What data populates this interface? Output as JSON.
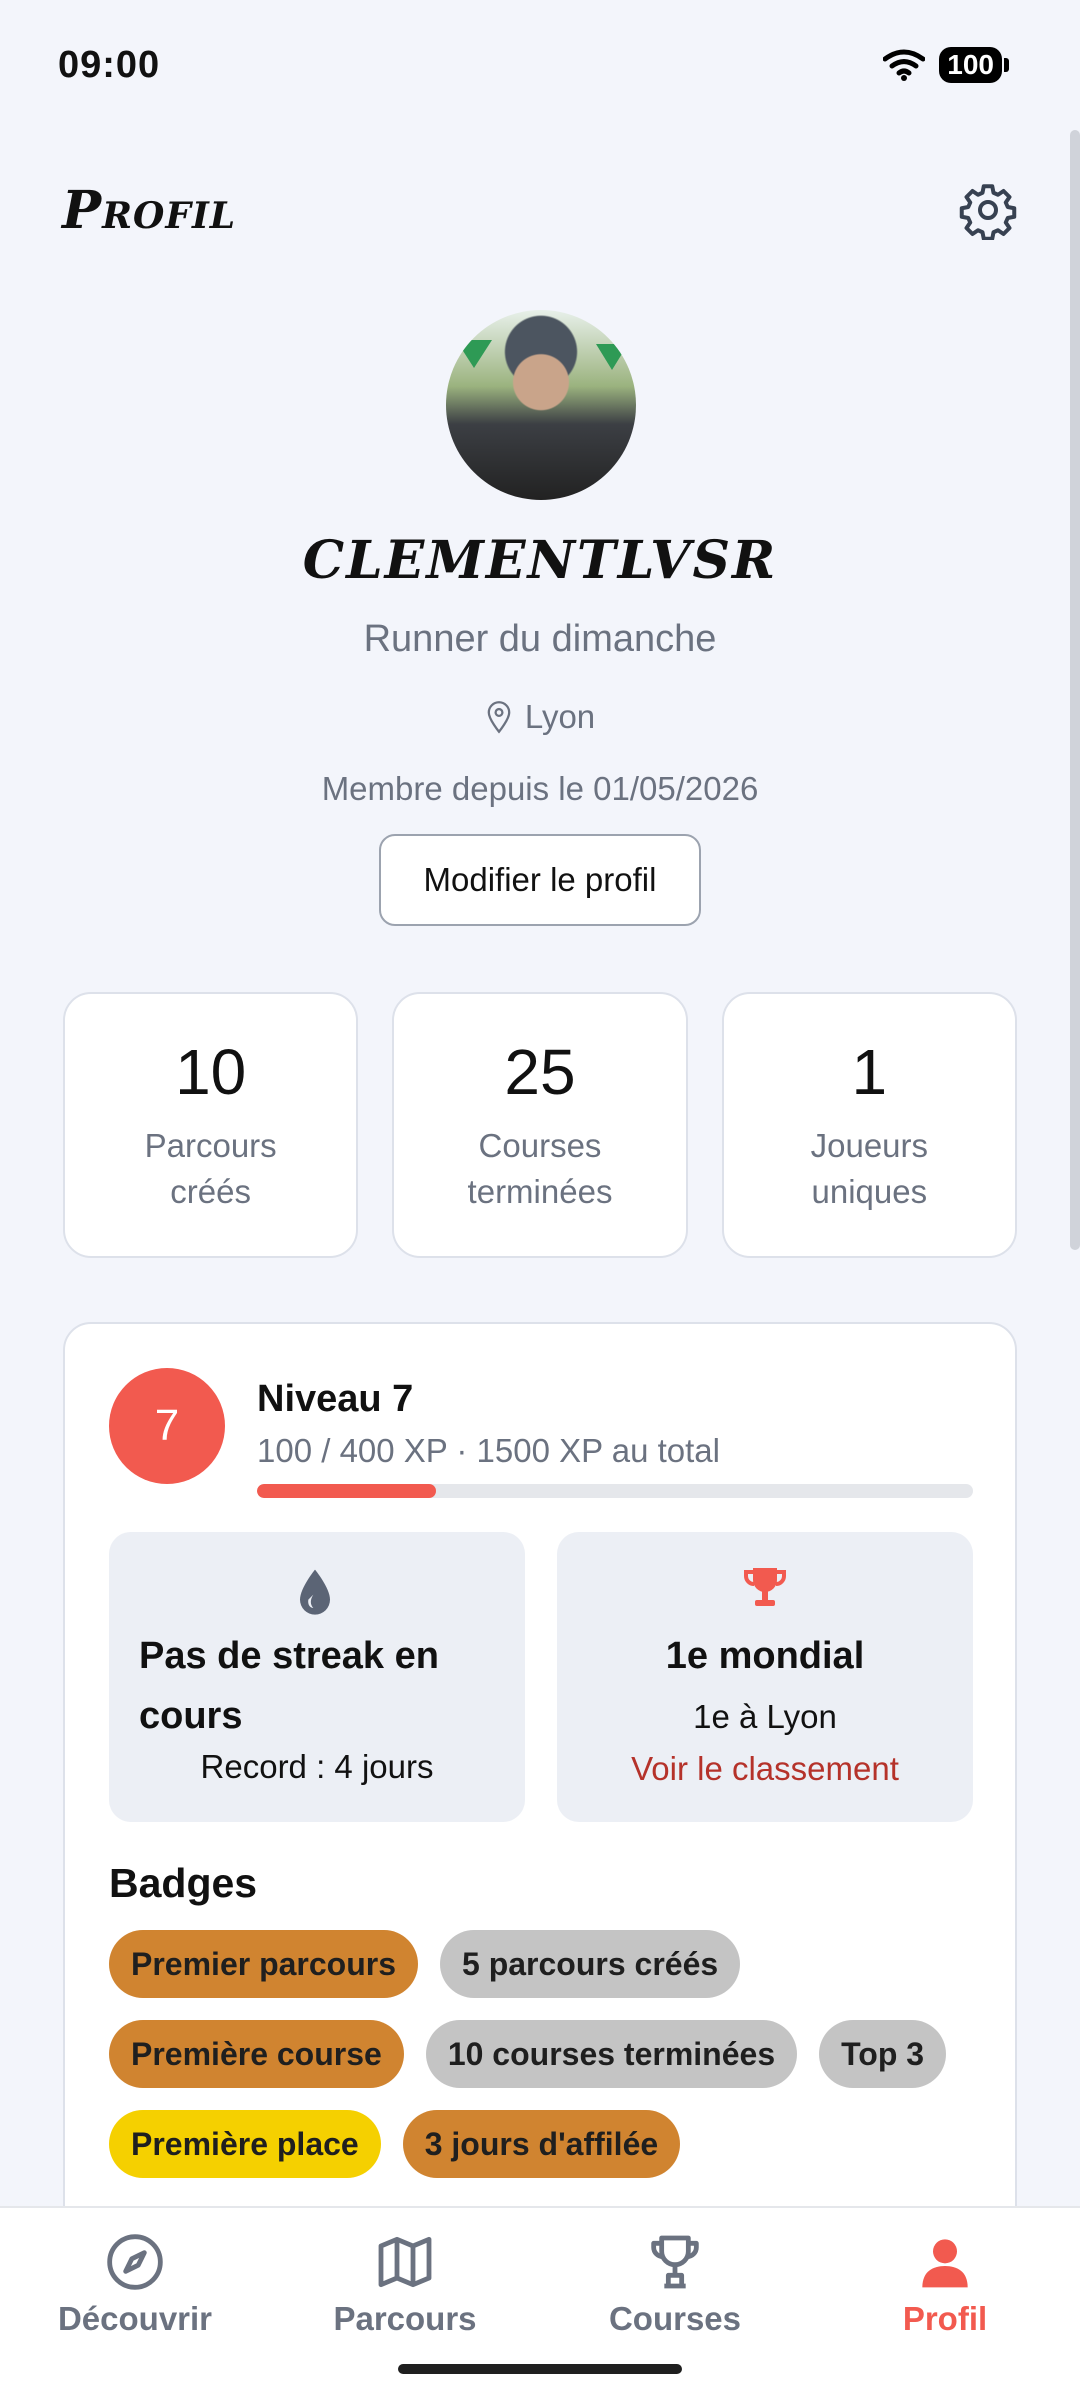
{
  "status_bar": {
    "time": "09:00",
    "battery": "100"
  },
  "header": {
    "title": "Profil",
    "settings_icon": "gear-icon"
  },
  "profile": {
    "username": "CLEMENTLVSR",
    "bio": "Runner du dimanche",
    "location": "Lyon",
    "member_since": "Membre depuis le 01/05/2026",
    "edit_button": "Modifier le profil"
  },
  "stats": [
    {
      "value": "10",
      "label": "Parcours\ncréés"
    },
    {
      "value": "25",
      "label": "Courses\nterminées"
    },
    {
      "value": "1",
      "label": "Joueurs\nuniques"
    }
  ],
  "level": {
    "number": "7",
    "title": "Niveau 7",
    "xp_text": "100 / 400 XP  ·  1500 XP au total",
    "progress": 0.25,
    "accent": "#f25a4f"
  },
  "streak": {
    "title": "Pas de streak en cours",
    "record": "Record : 4 jours",
    "icon": "flame-icon"
  },
  "ranking": {
    "title": "1e mondial",
    "city": "1e à Lyon",
    "link": "Voir le classement",
    "icon": "trophy-icon"
  },
  "badges": {
    "title": "Badges",
    "items": [
      {
        "label": "Premier parcours",
        "color": "#d08430"
      },
      {
        "label": "5 parcours créés",
        "color": "#c4c4c4"
      },
      {
        "label": "Première course",
        "color": "#d08430"
      },
      {
        "label": "10 courses terminées",
        "color": "#c4c4c4"
      },
      {
        "label": "Top 3",
        "color": "#c4c4c4"
      },
      {
        "label": "Première place",
        "color": "#f5d000"
      },
      {
        "label": "3 jours d'affilée",
        "color": "#d08430"
      }
    ]
  },
  "nav": {
    "items": [
      {
        "label": "Découvrir",
        "icon": "compass-icon",
        "active": false
      },
      {
        "label": "Parcours",
        "icon": "map-icon",
        "active": false
      },
      {
        "label": "Courses",
        "icon": "trophy-icon",
        "active": false
      },
      {
        "label": "Profil",
        "icon": "person-icon",
        "active": true
      }
    ],
    "active_color": "#f25a4f",
    "inactive_color": "#6b7280"
  }
}
